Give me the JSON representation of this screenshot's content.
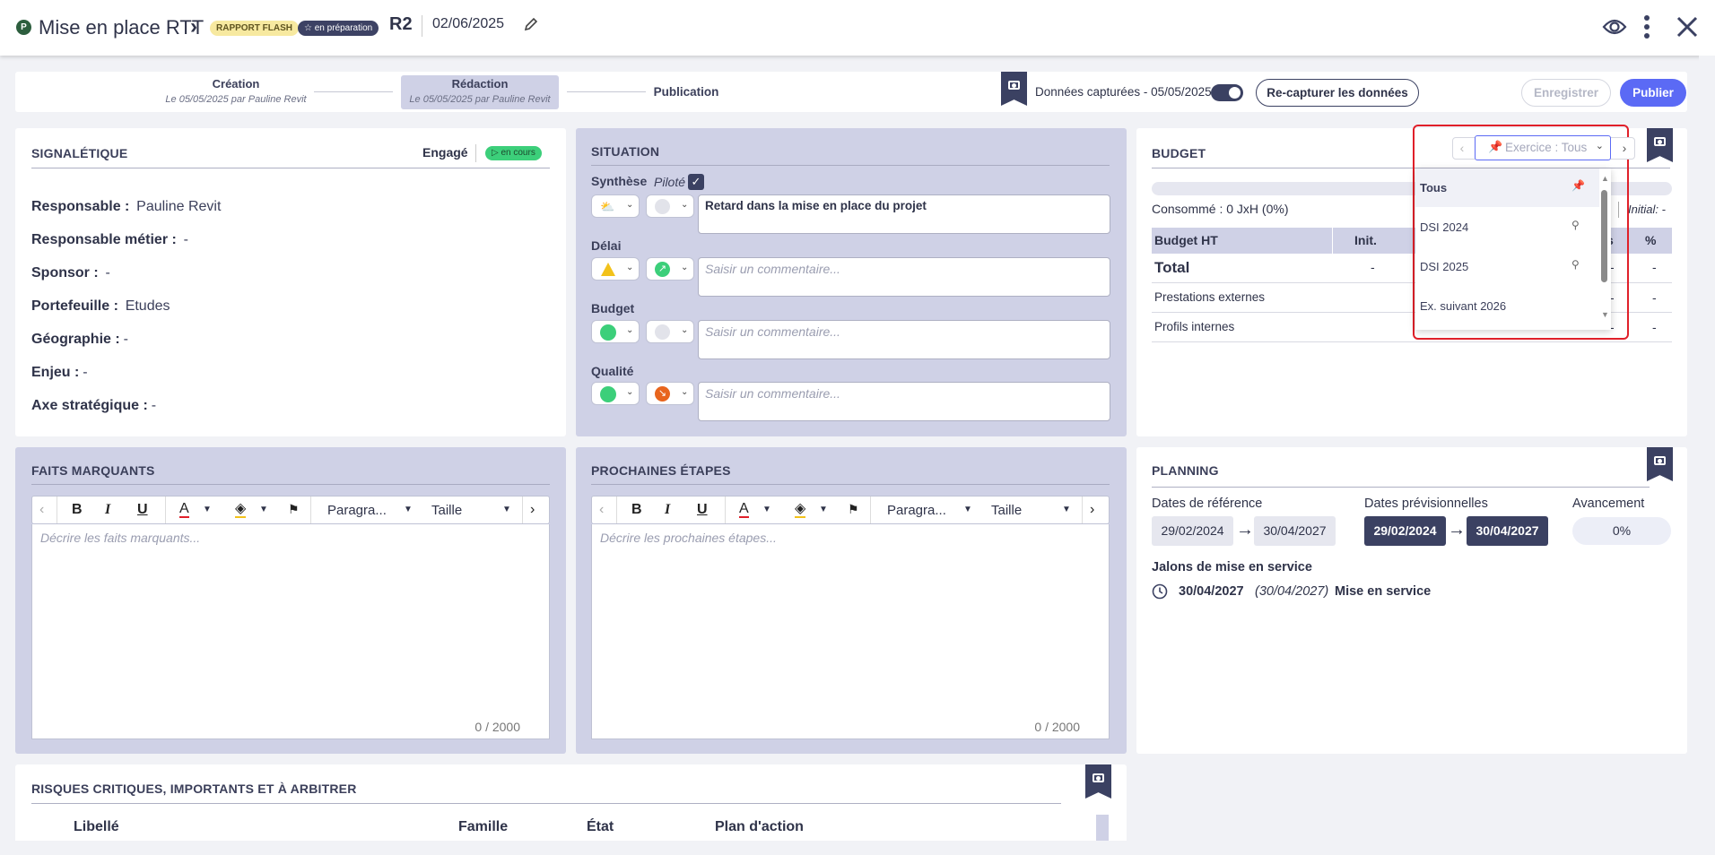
{
  "header": {
    "badge": "P",
    "title": "Mise en place RTT",
    "chevron": "›",
    "tag_flash": "RAPPORT FLASH",
    "tag_prep": "☆ en préparation",
    "report": "R2",
    "date": "02/06/2025"
  },
  "steps": [
    {
      "label": "Création",
      "sub": "Le 05/05/2025 par Pauline Revit"
    },
    {
      "label": "Rédaction",
      "sub": "Le 05/05/2025 par Pauline Revit"
    },
    {
      "label": "Publication",
      "sub": ""
    }
  ],
  "capture": {
    "text": "Données capturées - 05/05/2025",
    "recapture": "Re-capturer les données",
    "save": "Enregistrer",
    "publish": "Publier"
  },
  "signaletique": {
    "title": "SIGNALÉTIQUE",
    "engage": "Engagé",
    "status": "▷ en cours",
    "fields": [
      {
        "label": "Responsable :",
        "value": "Pauline Revit"
      },
      {
        "label": "Responsable métier :",
        "value": "-"
      },
      {
        "label": "Sponsor :",
        "value": "-"
      },
      {
        "label": "Portefeuille :",
        "value": "Etudes"
      },
      {
        "label": "Géographie :",
        "value": "-"
      },
      {
        "label": "Enjeu :",
        "value": "-"
      },
      {
        "label": "Axe stratégique :",
        "value": "-"
      }
    ]
  },
  "situation": {
    "title": "SITUATION",
    "synthese": "Synthèse",
    "pilote": "Piloté",
    "synthese_text": "Retard dans la mise en place du projet",
    "delai": "Délai",
    "budget": "Budget",
    "qualite": "Qualité",
    "placeholder": "Saisir un commentaire..."
  },
  "budget": {
    "title": "BUDGET",
    "consomme": "Consommé : 0 JxH (0%)",
    "initial": "Initial: -",
    "headers": [
      "Budget HT",
      "Init.",
      "%"
    ],
    "rows": [
      {
        "label": "Total",
        "init": "-",
        "a": "-",
        "b": "-"
      },
      {
        "label": "Prestations externes",
        "init": "",
        "a": "-",
        "b": "-"
      },
      {
        "label": "Profils internes",
        "init": "",
        "a": "-",
        "b": "-"
      }
    ],
    "partial_col": "s",
    "exercise_select": "Exercice : Tous",
    "options": [
      "Tous",
      "DSI 2024",
      "DSI 2025",
      "Ex. suivant 2026"
    ]
  },
  "faits": {
    "title": "FAITS MARQUANTS",
    "placeholder": "Décrire les faits marquants...",
    "counter": "0 / 2000",
    "paragraph": "Paragra...",
    "size": "Taille"
  },
  "etapes": {
    "title": "PROCHAINES ÉTAPES",
    "placeholder": "Décrire les prochaines étapes...",
    "counter": "0 / 2000",
    "paragraph": "Paragra...",
    "size": "Taille"
  },
  "planning": {
    "title": "PLANNING",
    "ref_label": "Dates de référence",
    "prev_label": "Dates prévisionnelles",
    "avancement_label": "Avancement",
    "ref_start": "29/02/2024",
    "ref_end": "30/04/2027",
    "prev_start": "29/02/2024",
    "prev_end": "30/04/2027",
    "avancement": "0%",
    "jalons_title": "Jalons de mise en service",
    "jalon": {
      "date": "30/04/2027",
      "ref": "(30/04/2027)",
      "label": "Mise en service"
    }
  },
  "risques": {
    "title": "RISQUES CRITIQUES, IMPORTANTS ET À ARBITRER",
    "cols": [
      "Libellé",
      "Famille",
      "État",
      "Plan d'action"
    ]
  },
  "colors": {
    "accent": "#5b6af5",
    "dark": "#3b4162",
    "lavender": "#cfd1e6",
    "highlight": "#e0202a",
    "green": "#3ccf7a",
    "yellow": "#f2c21b",
    "orange": "#e8651d"
  }
}
